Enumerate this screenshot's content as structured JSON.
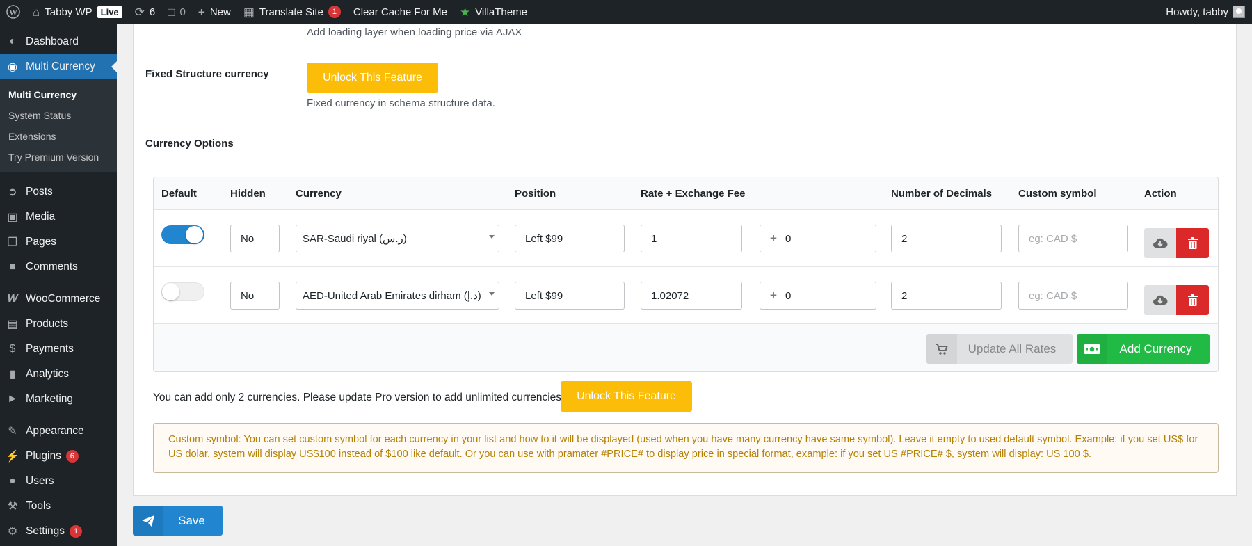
{
  "adminbar": {
    "site_name": "Tabby WP",
    "live_label": "Live",
    "updates_count": "6",
    "comments_count": "0",
    "new_label": "New",
    "translate_label": "Translate Site",
    "translate_badge": "1",
    "clear_cache_label": "Clear Cache For Me",
    "villatheme_label": "VillaTheme",
    "howdy_label": "Howdy, tabby"
  },
  "sidebar": {
    "dashboard": "Dashboard",
    "multi_currency": "Multi Currency",
    "submenu": [
      "Multi Currency",
      "System Status",
      "Extensions",
      "Try Premium Version"
    ],
    "posts": "Posts",
    "media": "Media",
    "pages": "Pages",
    "comments": "Comments",
    "woocommerce": "WooCommerce",
    "products": "Products",
    "payments": "Payments",
    "analytics": "Analytics",
    "marketing": "Marketing",
    "appearance": "Appearance",
    "plugins": "Plugins",
    "plugins_badge": "6",
    "users": "Users",
    "tools": "Tools",
    "settings": "Settings",
    "settings_badge": "1"
  },
  "content": {
    "loading_desc": "Add loading layer when loading price via AJAX",
    "fixed_structure_label": "Fixed Structure currency",
    "unlock_label": "Unlock This Feature",
    "fixed_structure_desc": "Fixed currency in schema structure data.",
    "currency_options_label": "Currency Options",
    "headers": {
      "default": "Default",
      "hidden": "Hidden",
      "currency": "Currency",
      "position": "Position",
      "rate": "Rate + Exchange Fee",
      "decimals": "Number of Decimals",
      "custom_symbol": "Custom symbol",
      "action": "Action"
    },
    "rows": [
      {
        "default_on": true,
        "hidden": "No",
        "currency": "SAR-Saudi riyal (ر.س)",
        "position": "Left $99",
        "rate": "1",
        "fee": "0",
        "decimals": "2",
        "symbol_placeholder": "eg: CAD $"
      },
      {
        "default_on": false,
        "hidden": "No",
        "currency": "AED-United Arab Emirates dirham (د.إ)",
        "position": "Left $99",
        "rate": "1.02072",
        "fee": "0",
        "decimals": "2",
        "symbol_placeholder": "eg: CAD $"
      }
    ],
    "update_rates_label": "Update All Rates",
    "add_currency_label": "Add Currency",
    "limit_text": "You can add only 2 currencies. Please update Pro version to add unlimited currencies.",
    "notice_text": "Custom symbol: You can set custom symbol for each currency in your list and how to it will be displayed (used when you have many currency have same symbol). Leave it empty to used default symbol. Example: if you set US$ for US dolar, system will display US$100 instead of $100 like default. Or you can use with pramater #PRICE# to display price in special format, example: if you set US #PRICE# $, system will display: US 100 $.",
    "save_label": "Save"
  },
  "colors": {
    "primary": "#2185d0",
    "yellow": "#fbbd08",
    "green": "#21ba45",
    "red": "#db2828",
    "admin_dark": "#1d2327"
  }
}
